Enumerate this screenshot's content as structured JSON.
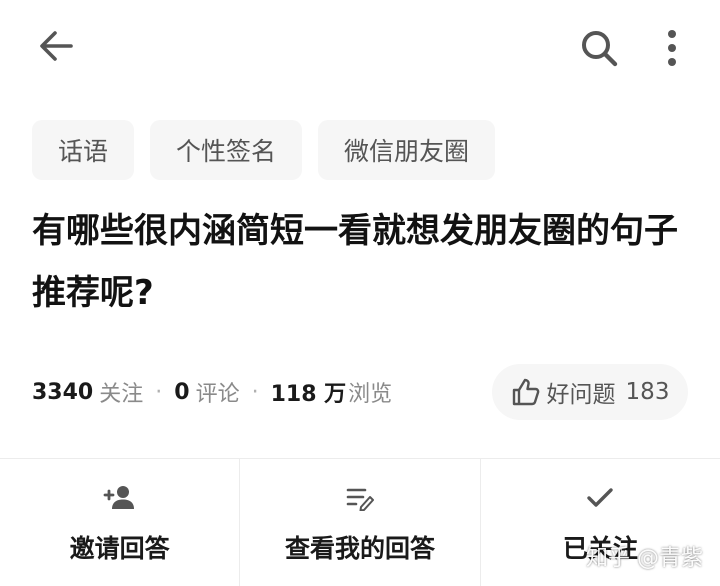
{
  "tags": [
    "话语",
    "个性签名",
    "微信朋友圈"
  ],
  "question": {
    "title": "有哪些很内涵简短一看就想发朋友圈的句子推荐呢?"
  },
  "stats": {
    "followers": "3340",
    "followers_label": "关注",
    "comments": "0",
    "comments_label": "评论",
    "views": "118 万",
    "views_label": "浏览",
    "separator": "·"
  },
  "good_question": {
    "label": "好问题",
    "count": "183"
  },
  "actions": {
    "invite": "邀请回答",
    "my_answer": "查看我的回答",
    "followed": "已关注"
  },
  "watermark": "知乎 @青紫",
  "colors": {
    "text_primary": "#1a1a1a",
    "text_secondary": "#8a8a8a",
    "chip_bg": "#f6f6f6",
    "icon": "#555555"
  }
}
